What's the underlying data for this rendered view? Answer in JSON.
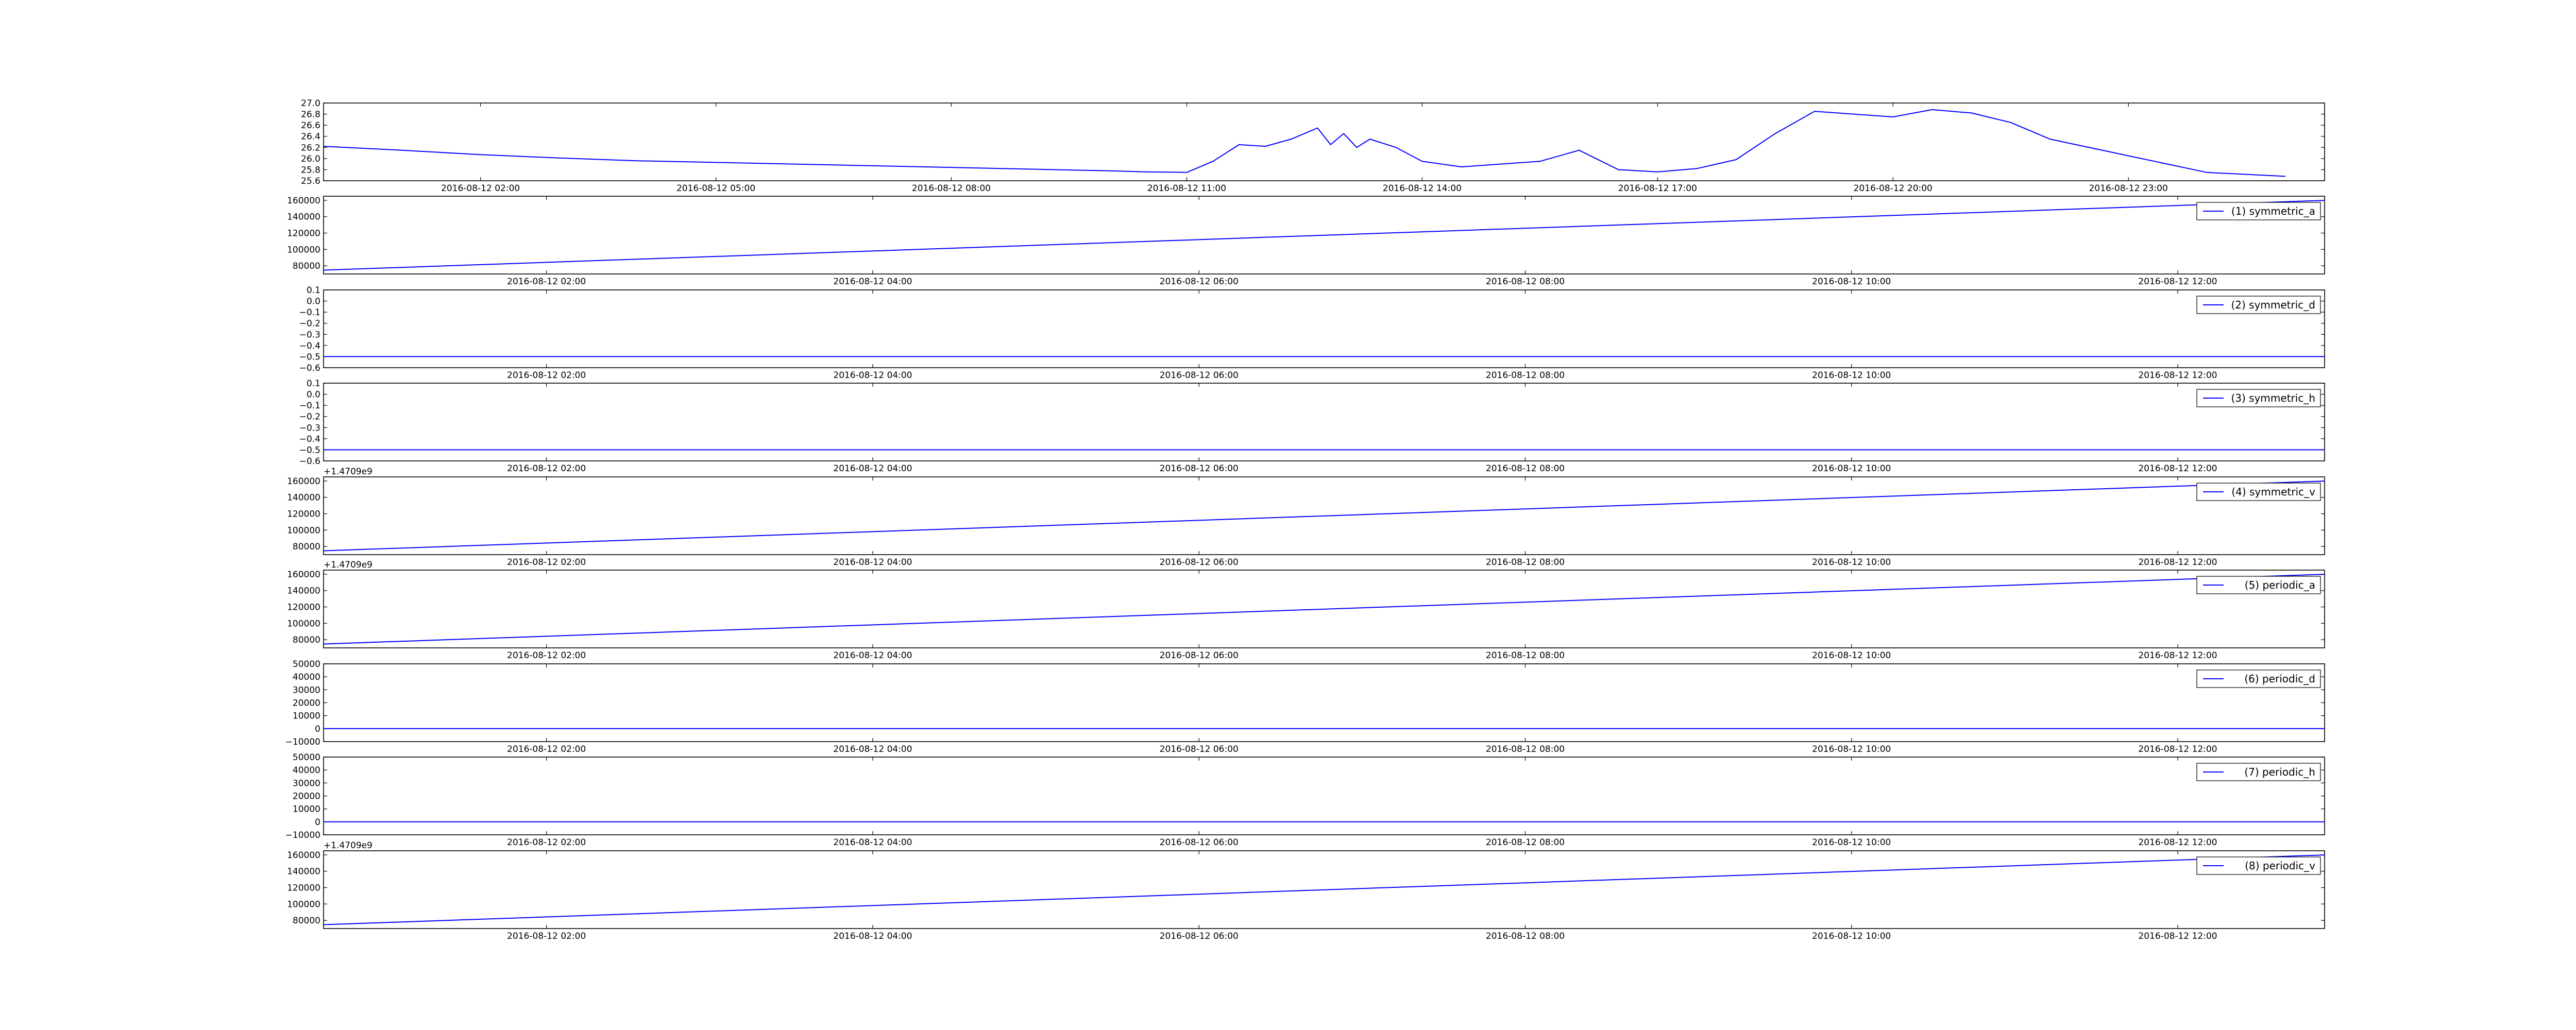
{
  "figure": {
    "line_color": "#0000ff",
    "axes_color": "#000000",
    "background": "#ffffff"
  },
  "chart_data": [
    {
      "type": "line",
      "id": "temperature",
      "offset_label": "",
      "legend": null,
      "ylim": [
        25.6,
        27.0
      ],
      "y_ticks": [
        "25.6",
        "25.8",
        "26.0",
        "26.2",
        "26.4",
        "26.6",
        "26.8",
        "27.0"
      ],
      "x_ticks": [
        "2016-08-12 02:00",
        "2016-08-12 05:00",
        "2016-08-12 08:00",
        "2016-08-12 11:00",
        "2016-08-12 14:00",
        "2016-08-12 17:00",
        "2016-08-12 20:00",
        "2016-08-12 23:00"
      ],
      "series": [
        {
          "x": [
            "2016-08-12 00:00",
            "2016-08-12 01:00",
            "2016-08-12 02:00",
            "2016-08-12 03:00",
            "2016-08-12 04:00",
            "2016-08-12 05:00",
            "2016-08-12 06:00",
            "2016-08-12 07:00",
            "2016-08-12 08:00",
            "2016-08-12 09:00",
            "2016-08-12 10:00",
            "2016-08-12 10:30",
            "2016-08-12 11:00",
            "2016-08-12 11:20",
            "2016-08-12 11:40",
            "2016-08-12 12:00",
            "2016-08-12 12:20",
            "2016-08-12 12:40",
            "2016-08-12 12:50",
            "2016-08-12 13:00",
            "2016-08-12 13:10",
            "2016-08-12 13:20",
            "2016-08-12 13:40",
            "2016-08-12 14:00",
            "2016-08-12 14:30",
            "2016-08-12 15:00",
            "2016-08-12 15:30",
            "2016-08-12 16:00",
            "2016-08-12 16:30",
            "2016-08-12 17:00",
            "2016-08-12 17:30",
            "2016-08-12 18:00",
            "2016-08-12 18:30",
            "2016-08-12 19:00",
            "2016-08-12 19:30",
            "2016-08-12 20:00",
            "2016-08-12 20:30",
            "2016-08-12 21:00",
            "2016-08-12 21:30",
            "2016-08-12 22:00",
            "2016-08-12 23:00",
            "2016-08-13 00:00",
            "2016-08-13 01:00"
          ],
          "y": [
            26.22,
            26.15,
            26.07,
            26.01,
            25.96,
            25.93,
            25.9,
            25.87,
            25.84,
            25.81,
            25.78,
            25.76,
            25.75,
            25.95,
            26.25,
            26.22,
            26.35,
            26.55,
            26.25,
            26.45,
            26.2,
            26.35,
            26.2,
            25.95,
            25.85,
            25.9,
            25.95,
            26.15,
            25.8,
            25.76,
            25.82,
            25.98,
            26.45,
            26.85,
            26.8,
            26.75,
            26.88,
            26.82,
            26.65,
            26.35,
            26.05,
            25.75,
            25.68
          ]
        }
      ]
    },
    {
      "type": "line",
      "id": "symmetric_a",
      "offset_label": "",
      "legend": "(1) symmetric_a",
      "ylim": [
        70000,
        165000
      ],
      "y_ticks": [
        "80000",
        "100000",
        "120000",
        "140000",
        "160000"
      ],
      "x_ticks": [
        "2016-08-12 02:00",
        "2016-08-12 04:00",
        "2016-08-12 06:00",
        "2016-08-12 08:00",
        "2016-08-12 10:00",
        "2016-08-12 12:00"
      ],
      "series": [
        {
          "x": [
            "2016-08-12 00:38",
            "2016-08-12 12:54"
          ],
          "y": [
            74700,
            159900
          ]
        }
      ]
    },
    {
      "type": "line",
      "id": "symmetric_d",
      "offset_label": "",
      "legend": "(2) symmetric_d",
      "ylim": [
        -0.6,
        0.1
      ],
      "y_ticks": [
        "−0.6",
        "−0.5",
        "−0.4",
        "−0.3",
        "−0.2",
        "−0.1",
        "0.0",
        "0.1"
      ],
      "x_ticks": [
        "2016-08-12 02:00",
        "2016-08-12 04:00",
        "2016-08-12 06:00",
        "2016-08-12 08:00",
        "2016-08-12 10:00",
        "2016-08-12 12:00"
      ],
      "series": [
        {
          "x": [
            "2016-08-12 00:38",
            "2016-08-12 12:54"
          ],
          "y": [
            -0.5,
            -0.5
          ]
        }
      ]
    },
    {
      "type": "line",
      "id": "symmetric_h",
      "offset_label": "",
      "legend": "(3) symmetric_h",
      "ylim": [
        -0.6,
        0.1
      ],
      "y_ticks": [
        "−0.6",
        "−0.5",
        "−0.4",
        "−0.3",
        "−0.2",
        "−0.1",
        "0.0",
        "0.1"
      ],
      "x_ticks": [
        "2016-08-12 02:00",
        "2016-08-12 04:00",
        "2016-08-12 06:00",
        "2016-08-12 08:00",
        "2016-08-12 10:00",
        "2016-08-12 12:00"
      ],
      "series": [
        {
          "x": [
            "2016-08-12 00:38",
            "2016-08-12 12:54"
          ],
          "y": [
            -0.5,
            -0.5
          ]
        }
      ]
    },
    {
      "type": "line",
      "id": "symmetric_v",
      "offset_label": "+1.4709e9",
      "legend": "(4) symmetric_v",
      "ylim": [
        70000,
        165000
      ],
      "y_ticks": [
        "80000",
        "100000",
        "120000",
        "140000",
        "160000"
      ],
      "x_ticks": [
        "2016-08-12 02:00",
        "2016-08-12 04:00",
        "2016-08-12 06:00",
        "2016-08-12 08:00",
        "2016-08-12 10:00",
        "2016-08-12 12:00"
      ],
      "series": [
        {
          "x": [
            "2016-08-12 00:38",
            "2016-08-12 12:54"
          ],
          "y": [
            74700,
            159900
          ]
        }
      ]
    },
    {
      "type": "line",
      "id": "periodic_a",
      "offset_label": "+1.4709e9",
      "legend": "(5) periodic_a",
      "ylim": [
        70000,
        165000
      ],
      "y_ticks": [
        "80000",
        "100000",
        "120000",
        "140000",
        "160000"
      ],
      "x_ticks": [
        "2016-08-12 02:00",
        "2016-08-12 04:00",
        "2016-08-12 06:00",
        "2016-08-12 08:00",
        "2016-08-12 10:00",
        "2016-08-12 12:00"
      ],
      "series": [
        {
          "x": [
            "2016-08-12 00:38",
            "2016-08-12 12:54"
          ],
          "y": [
            74700,
            159900
          ]
        }
      ]
    },
    {
      "type": "line",
      "id": "periodic_d",
      "offset_label": "",
      "legend": "(6) periodic_d",
      "ylim": [
        -10000,
        50000
      ],
      "y_ticks": [
        "−10000",
        "0",
        "10000",
        "20000",
        "30000",
        "40000",
        "50000"
      ],
      "x_ticks": [
        "2016-08-12 02:00",
        "2016-08-12 04:00",
        "2016-08-12 06:00",
        "2016-08-12 08:00",
        "2016-08-12 10:00",
        "2016-08-12 12:00"
      ],
      "series": [
        {
          "x": [
            "2016-08-12 00:38",
            "2016-08-12 12:54"
          ],
          "y": [
            0,
            0
          ]
        }
      ]
    },
    {
      "type": "line",
      "id": "periodic_h",
      "offset_label": "",
      "legend": "(7) periodic_h",
      "ylim": [
        -10000,
        50000
      ],
      "y_ticks": [
        "−10000",
        "0",
        "10000",
        "20000",
        "30000",
        "40000",
        "50000"
      ],
      "x_ticks": [
        "2016-08-12 02:00",
        "2016-08-12 04:00",
        "2016-08-12 06:00",
        "2016-08-12 08:00",
        "2016-08-12 10:00",
        "2016-08-12 12:00"
      ],
      "series": [
        {
          "x": [
            "2016-08-12 00:38",
            "2016-08-12 12:54"
          ],
          "y": [
            0,
            0
          ]
        }
      ]
    },
    {
      "type": "line",
      "id": "periodic_v",
      "offset_label": "+1.4709e9",
      "legend": "(8) periodic_v",
      "ylim": [
        70000,
        165000
      ],
      "y_ticks": [
        "80000",
        "100000",
        "120000",
        "140000",
        "160000"
      ],
      "x_ticks": [
        "2016-08-12 02:00",
        "2016-08-12 04:00",
        "2016-08-12 06:00",
        "2016-08-12 08:00",
        "2016-08-12 10:00",
        "2016-08-12 12:00"
      ],
      "series": [
        {
          "x": [
            "2016-08-12 00:38",
            "2016-08-12 12:54"
          ],
          "y": [
            74700,
            159900
          ]
        }
      ]
    }
  ]
}
